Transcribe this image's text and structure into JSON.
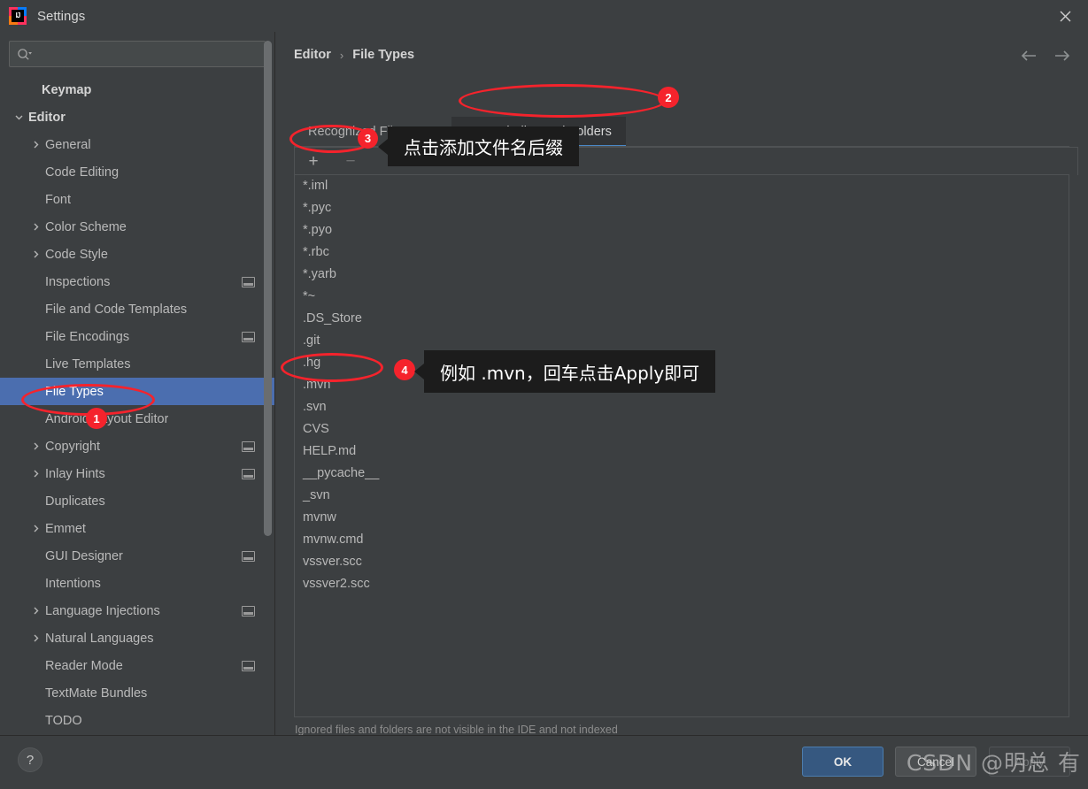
{
  "window": {
    "title": "Settings",
    "app_icon": "intellij-idea-logo",
    "close_icon": "close-icon"
  },
  "search": {
    "placeholder": "",
    "value": "",
    "icon": "search-icon"
  },
  "sidebar": {
    "items": [
      {
        "label": "Keymap",
        "level": 0,
        "arrow": "none",
        "selected": false,
        "project_icon": false
      },
      {
        "label": "Editor",
        "level": 0,
        "arrow": "expanded",
        "selected": false,
        "project_icon": false
      },
      {
        "label": "General",
        "level": 1,
        "arrow": "collapsed",
        "selected": false,
        "project_icon": false
      },
      {
        "label": "Code Editing",
        "level": 1,
        "arrow": "none",
        "selected": false,
        "project_icon": false
      },
      {
        "label": "Font",
        "level": 1,
        "arrow": "none",
        "selected": false,
        "project_icon": false
      },
      {
        "label": "Color Scheme",
        "level": 1,
        "arrow": "collapsed",
        "selected": false,
        "project_icon": false
      },
      {
        "label": "Code Style",
        "level": 1,
        "arrow": "collapsed",
        "selected": false,
        "project_icon": false
      },
      {
        "label": "Inspections",
        "level": 1,
        "arrow": "none",
        "selected": false,
        "project_icon": true
      },
      {
        "label": "File and Code Templates",
        "level": 1,
        "arrow": "none",
        "selected": false,
        "project_icon": false
      },
      {
        "label": "File Encodings",
        "level": 1,
        "arrow": "none",
        "selected": false,
        "project_icon": true
      },
      {
        "label": "Live Templates",
        "level": 1,
        "arrow": "none",
        "selected": false,
        "project_icon": false
      },
      {
        "label": "File Types",
        "level": 1,
        "arrow": "none",
        "selected": true,
        "project_icon": false
      },
      {
        "label": "Android Layout Editor",
        "level": 1,
        "arrow": "none",
        "selected": false,
        "project_icon": false
      },
      {
        "label": "Copyright",
        "level": 1,
        "arrow": "collapsed",
        "selected": false,
        "project_icon": true
      },
      {
        "label": "Inlay Hints",
        "level": 1,
        "arrow": "collapsed",
        "selected": false,
        "project_icon": true
      },
      {
        "label": "Duplicates",
        "level": 1,
        "arrow": "none",
        "selected": false,
        "project_icon": false
      },
      {
        "label": "Emmet",
        "level": 1,
        "arrow": "collapsed",
        "selected": false,
        "project_icon": false
      },
      {
        "label": "GUI Designer",
        "level": 1,
        "arrow": "none",
        "selected": false,
        "project_icon": true
      },
      {
        "label": "Intentions",
        "level": 1,
        "arrow": "none",
        "selected": false,
        "project_icon": false
      },
      {
        "label": "Language Injections",
        "level": 1,
        "arrow": "collapsed",
        "selected": false,
        "project_icon": true
      },
      {
        "label": "Natural Languages",
        "level": 1,
        "arrow": "collapsed",
        "selected": false,
        "project_icon": false
      },
      {
        "label": "Reader Mode",
        "level": 1,
        "arrow": "none",
        "selected": false,
        "project_icon": true
      },
      {
        "label": "TextMate Bundles",
        "level": 1,
        "arrow": "none",
        "selected": false,
        "project_icon": false
      },
      {
        "label": "TODO",
        "level": 1,
        "arrow": "none",
        "selected": false,
        "project_icon": false
      }
    ]
  },
  "main": {
    "breadcrumb": {
      "parent": "Editor",
      "separator": "›",
      "current": "File Types"
    },
    "nav": {
      "back_icon": "arrow-left-icon",
      "forward_icon": "arrow-right-icon"
    },
    "tabs": [
      {
        "label": "Recognized File Types",
        "active": false
      },
      {
        "label": "Ignored Files and Folders",
        "active": true
      }
    ],
    "toolbar": {
      "add_label": "+",
      "add_icon": "plus-icon",
      "remove_label": "−",
      "remove_icon": "minus-icon",
      "remove_disabled": true
    },
    "ignored_list": [
      "*.iml",
      "*.pyc",
      "*.pyo",
      "*.rbc",
      "*.yarb",
      "*~",
      ".DS_Store",
      ".git",
      ".hg",
      ".mvn",
      ".svn",
      "CVS",
      "HELP.md",
      "__pycache__",
      "_svn",
      "mvnw",
      "mvnw.cmd",
      "vssver.scc",
      "vssver2.scc"
    ],
    "hint": "Ignored files and folders are not visible in the IDE and not indexed"
  },
  "footer": {
    "help_label": "?",
    "ok_label": "OK",
    "cancel_label": "Cancel",
    "apply_label": "Apply"
  },
  "annotations": {
    "badges": [
      {
        "number": "1"
      },
      {
        "number": "2"
      },
      {
        "number": "3"
      },
      {
        "number": "4"
      }
    ],
    "tooltips": [
      {
        "text": "点击添加文件名后缀"
      },
      {
        "text": "例如 .mvn，回车点击Apply即可"
      }
    ],
    "accent_color": "#f5232c"
  },
  "watermark": {
    "text": "CSDN @明总 有"
  }
}
